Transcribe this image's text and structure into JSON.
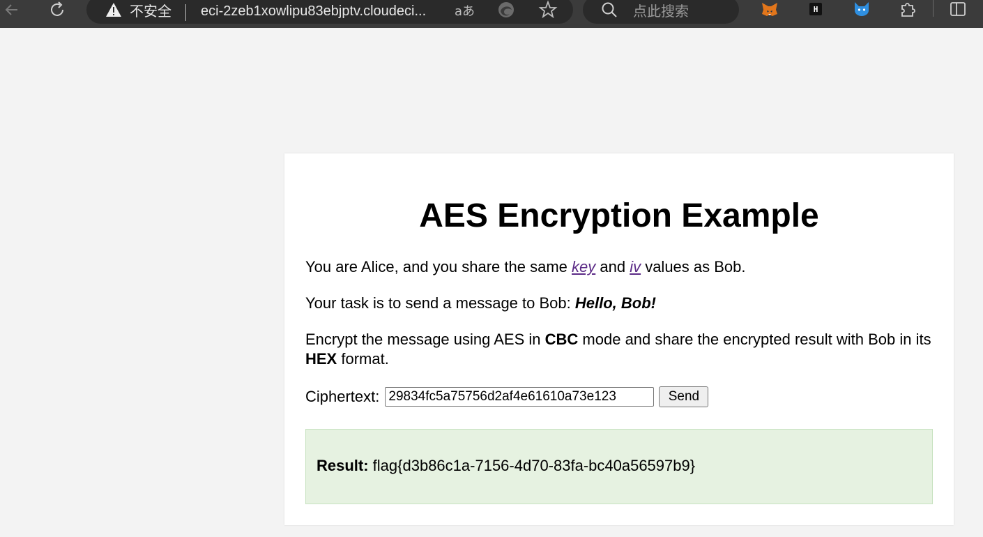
{
  "browser": {
    "insecure_label": "不安全",
    "url": "eci-2zeb1xowlipu83ebjptv.cloudeci...",
    "translate_glyph": "aあ",
    "search_placeholder": "点此搜索",
    "icons": [
      "back-icon",
      "reload-icon",
      "warning-icon",
      "translate-icon",
      "edge-icon",
      "star-icon",
      "search-icon",
      "metamask-icon",
      "hackbar-icon",
      "fox-extension-icon",
      "extensions-icon",
      "split-screen-icon"
    ]
  },
  "page": {
    "title": "AES Encryption Example",
    "p1": {
      "before": "You are Alice, and you share the same ",
      "key": "key",
      "mid": " and ",
      "iv": "iv",
      "after": " values as Bob."
    },
    "p2": {
      "before": "Your task is to send a message to Bob: ",
      "message": "Hello, Bob!"
    },
    "p3": {
      "before": "Encrypt the message using AES in ",
      "mode": "CBC",
      "mid": " mode and share the encrypted result with Bob in its ",
      "format": "HEX",
      "after": " format."
    },
    "form": {
      "label": "Ciphertext:",
      "value": "29834fc5a75756d2af4e61610a73e123",
      "button": "Send"
    },
    "result": {
      "label": "Result:",
      "value": " flag{d3b86c1a-7156-4d70-83fa-bc40a56597b9}"
    }
  },
  "colors": {
    "chrome_bg": "#3b3b3b",
    "page_bg": "#f3f3f3",
    "link": "#5b2a86",
    "result_bg": "#e6f2e1"
  }
}
